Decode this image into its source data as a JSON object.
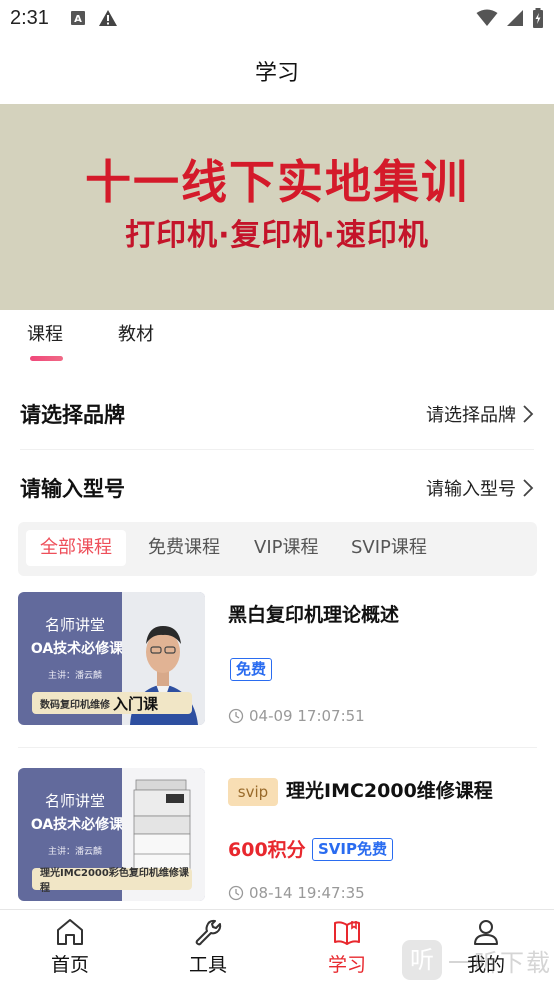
{
  "status_bar": {
    "time": "2:31",
    "icons": [
      "keyboard-a-icon",
      "warning-icon",
      "wifi-icon",
      "signal-icon",
      "battery-charging-icon"
    ]
  },
  "header": {
    "title": "学习"
  },
  "banner": {
    "line1": "十一线下实地集训",
    "line2": "打印机·复印机·速印机",
    "colors": {
      "background": "#d4d2bd",
      "text": "#d41a2a"
    }
  },
  "tabs": [
    {
      "label": "课程",
      "active": true
    },
    {
      "label": "教材",
      "active": false
    }
  ],
  "selectors": [
    {
      "label": "请选择品牌",
      "value": "请选择品牌"
    },
    {
      "label": "请输入型号",
      "value": "请输入型号"
    }
  ],
  "filters": [
    {
      "label": "全部课程",
      "active": true
    },
    {
      "label": "免费课程",
      "active": false
    },
    {
      "label": "VIP课程",
      "active": false
    },
    {
      "label": "SVIP课程",
      "active": false
    }
  ],
  "courses": [
    {
      "title": "黑白复印机理论概述",
      "tag": "免费",
      "time": "04-09 17:07:51",
      "thumbnail": {
        "line1": "名师讲堂",
        "line2": "OA技术必修课",
        "line3": "主讲：潘云麟",
        "ribbon": "数码复印机维修",
        "ribbon_big": "入门课"
      }
    },
    {
      "title": "理光IMC2000维修课程",
      "level_tag": "svip",
      "price": "600积分",
      "tag": "SVIP免费",
      "time": "08-14 19:47:35",
      "thumbnail": {
        "line1": "名师讲堂",
        "line2": "OA技术必修课",
        "line3": "主讲：潘云麟",
        "ribbon": "理光IMC2000彩色复印机维修课程"
      }
    }
  ],
  "bottom_nav": [
    {
      "label": "首页",
      "icon": "home-icon",
      "active": false
    },
    {
      "label": "工具",
      "icon": "wrench-icon",
      "active": false
    },
    {
      "label": "学习",
      "icon": "open-book-icon",
      "active": true
    },
    {
      "label": "我的",
      "icon": "user-icon",
      "active": false
    }
  ],
  "watermark": {
    "badge": "听",
    "text": "一听下载"
  },
  "colors": {
    "accent": "#e8282e",
    "tag_blue": "#2a6cf0",
    "filter_active": "#ee4f5a"
  }
}
